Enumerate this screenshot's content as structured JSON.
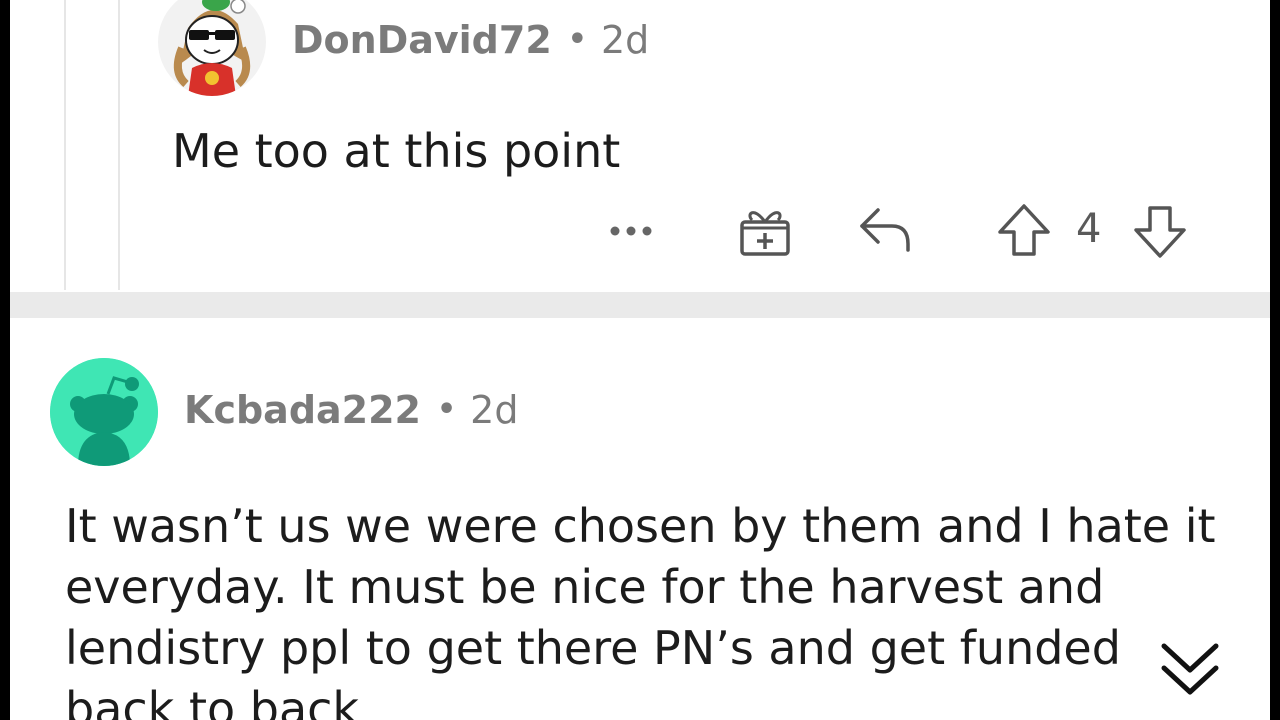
{
  "comment1": {
    "username": "DonDavid72",
    "separator": "•",
    "age": "2d",
    "body": "Me too at this point",
    "vote_count": "4",
    "avatar_icon": "snoo-avatar-sunglasses-icon"
  },
  "comment2": {
    "username": "Kcbada222",
    "separator": "•",
    "age": "2d",
    "body": "It wasn’t us we were chosen by them and I hate it everyday. It must be nice for the harvest and lendistry ppl to get there PN’s and get funded back to back",
    "avatar_icon": "snoo-default-avatar-icon"
  },
  "icons": {
    "more": "more-options-icon",
    "award": "award-gift-icon",
    "reply": "reply-arrow-icon",
    "upvote": "upvote-arrow-icon",
    "downvote": "downvote-arrow-icon",
    "scroll": "scroll-down-chevron-icon"
  },
  "colors": {
    "avatar2_bg": "#3fe6b4",
    "meta_text": "#7b7b7b",
    "body_text": "#1c1c1c",
    "separator": "#eaeaea"
  }
}
